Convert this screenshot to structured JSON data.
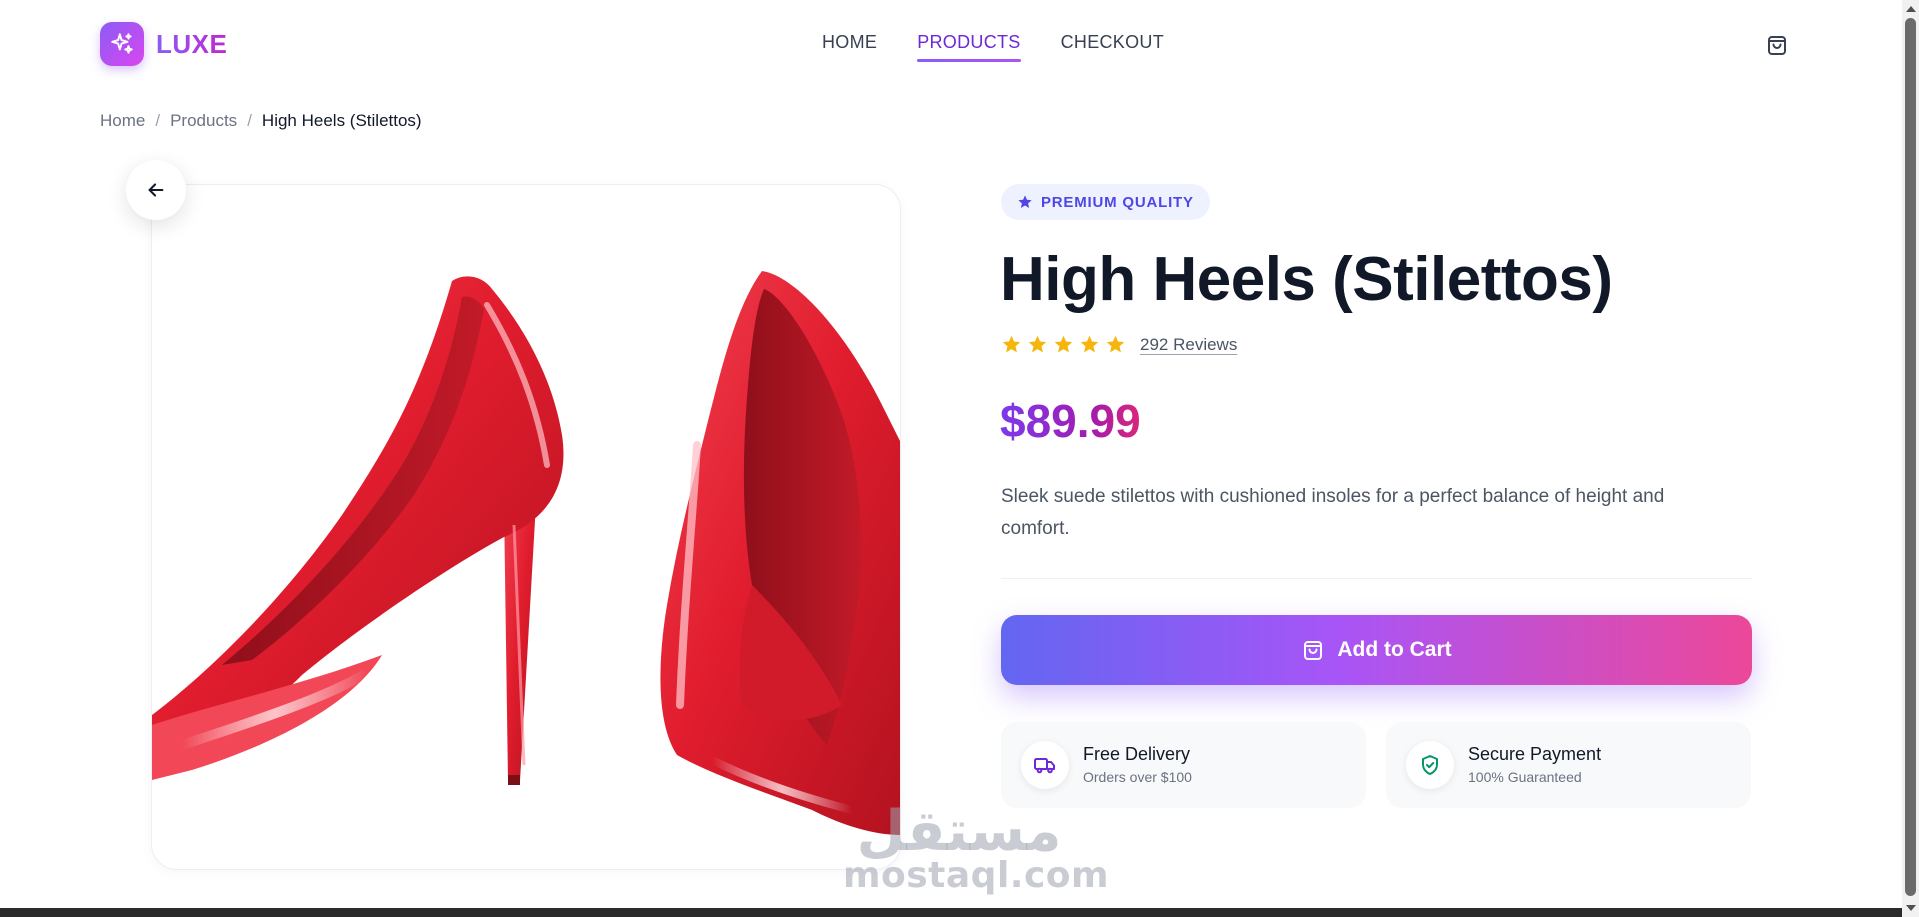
{
  "brand": {
    "name": "LUXE",
    "accent": "#8b5cf6",
    "accent2": "#ec4899"
  },
  "nav": {
    "items": [
      {
        "label": "HOME",
        "active": false
      },
      {
        "label": "PRODUCTS",
        "active": true
      },
      {
        "label": "CHECKOUT",
        "active": false
      }
    ],
    "cart_icon": "shopping-bag-icon"
  },
  "breadcrumb": {
    "items": [
      "Home",
      "Products",
      "High Heels (Stilettos)"
    ],
    "separator": "/"
  },
  "product": {
    "badge": "PREMIUM QUALITY",
    "title": "High Heels (Stilettos)",
    "rating": 5,
    "reviews": "292 Reviews",
    "price": "$89.99",
    "description": "Sleek suede stilettos with cushioned insoles for a perfect balance of height and comfort.",
    "image_subject": "red patent stiletto pumps",
    "shoe_color": "#e11d2e"
  },
  "actions": {
    "add_to_cart": "Add to Cart"
  },
  "features": [
    {
      "title": "Free Delivery",
      "subtitle": "Orders over $100",
      "icon": "truck-icon",
      "color": "#6d28d9"
    },
    {
      "title": "Secure Payment",
      "subtitle": "100% Guaranteed",
      "icon": "shield-check-icon",
      "color": "#059669"
    }
  ],
  "watermark": {
    "arabic": "مستقل",
    "latin": "mostaql.com"
  }
}
